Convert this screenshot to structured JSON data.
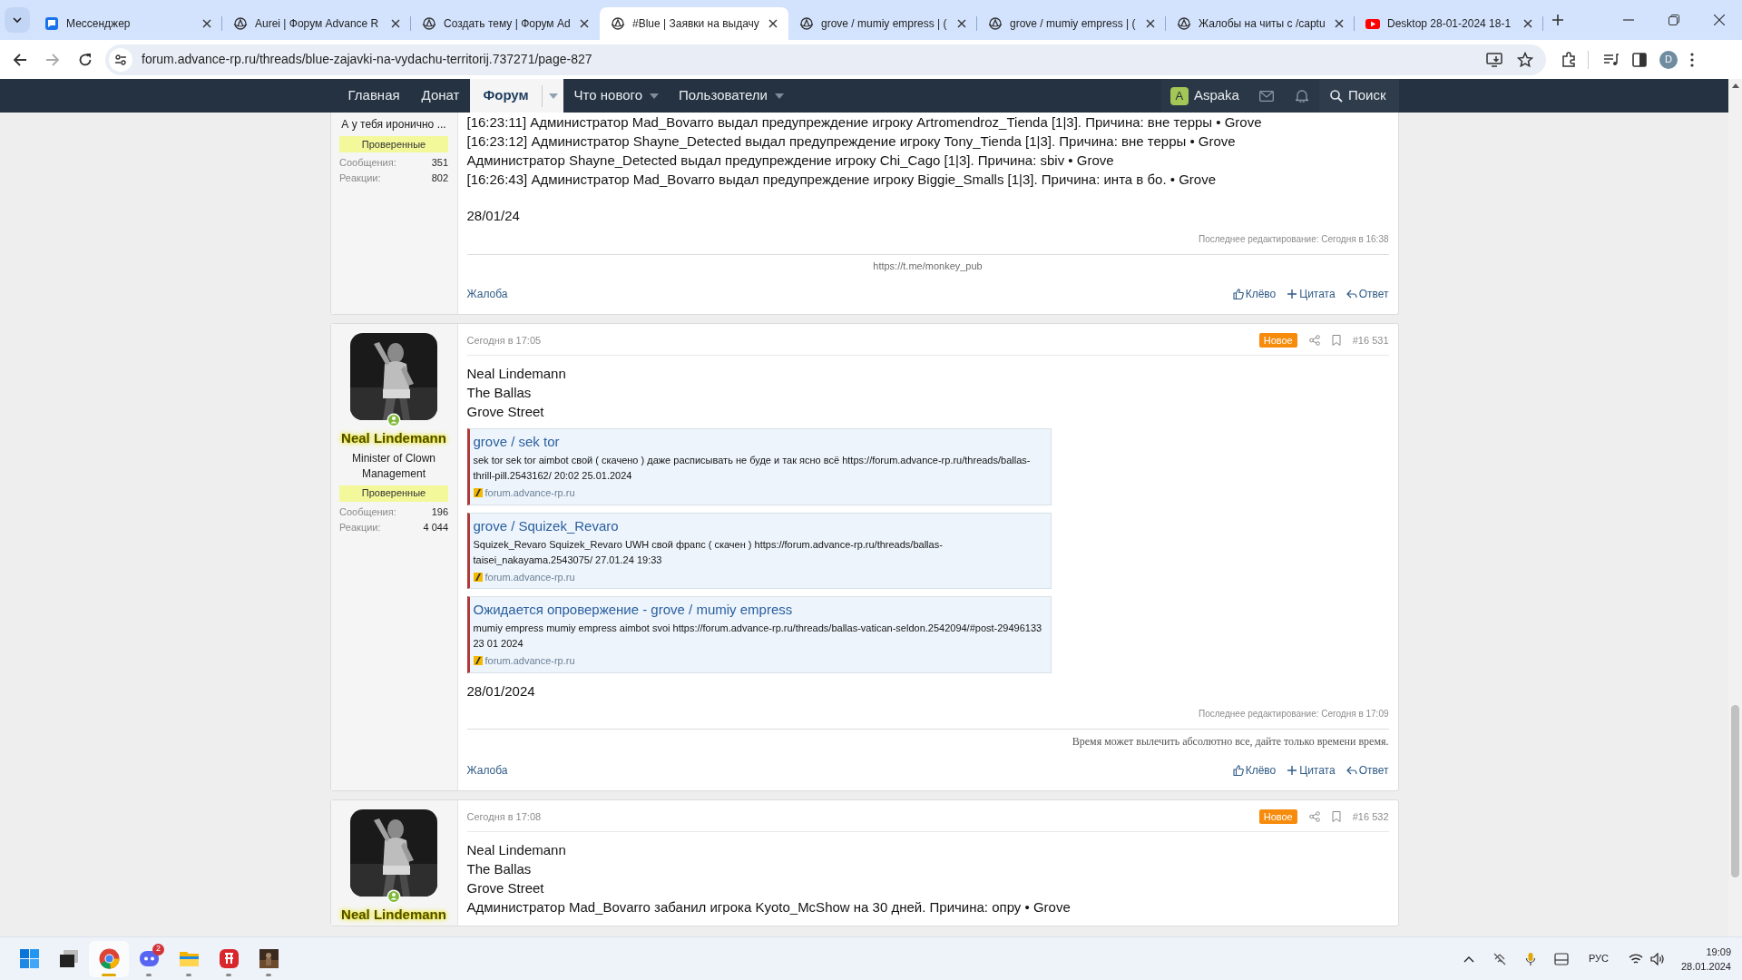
{
  "browser": {
    "tabs": [
      {
        "title": "Мессенджер",
        "kind": "messenger",
        "selected": false
      },
      {
        "title": "Aurei | Форум Advance R",
        "kind": "forum",
        "selected": false
      },
      {
        "title": "Создать тему | Форум Ad",
        "kind": "forum",
        "selected": false
      },
      {
        "title": "#Blue | Заявки на выдачу",
        "kind": "forum",
        "selected": true
      },
      {
        "title": "grove / mumiy empress | (",
        "kind": "forum",
        "selected": false
      },
      {
        "title": "grove / mumiy empress | (",
        "kind": "forum",
        "selected": false
      },
      {
        "title": "Жалобы на читы с /captu",
        "kind": "forum",
        "selected": false
      },
      {
        "title": "Desktop 28-01-2024 18-1",
        "kind": "video",
        "selected": false
      }
    ],
    "address": "forum.advance-rp.ru/threads/blue-zajavki-na-vydachu-territorij.737271/page-827",
    "profile_initial": "D"
  },
  "nav": {
    "items": [
      {
        "label": "Главная",
        "selected": false,
        "dropdown": false
      },
      {
        "label": "Донат",
        "selected": false,
        "dropdown": false
      },
      {
        "label": "Форум",
        "selected": true,
        "dropdown": true
      },
      {
        "label": "Что нового",
        "selected": false,
        "dropdown": true
      },
      {
        "label": "Пользователи",
        "selected": false,
        "dropdown": true
      }
    ],
    "user": {
      "initial": "A",
      "name": "Aspaka"
    },
    "search": "Поиск"
  },
  "posts": [
    {
      "user": {
        "title": "А у тебя иронично ...",
        "badge": "Проверенные",
        "stats": [
          {
            "label": "Сообщения:",
            "value": "351"
          },
          {
            "label": "Реакции:",
            "value": "802"
          }
        ]
      },
      "lines": [
        "[16:23:11] Администратор Mad_Bovarro выдал предупреждение игроку Artromendroz_Tienda [1|3]. Причина: вне терры • Grove",
        "[16:23:12] Администратор Shayne_Detected выдал предупреждение игроку Tony_Tienda [1|3]. Причина: вне терры • Grove",
        "Администратор Shayne_Detected выдал предупреждение игроку Chi_Cago [1|3]. Причина: sbiv • Grove",
        "[16:26:43] Администратор Mad_Bovarro выдал предупреждение игроку Biggie_Smalls [1|3]. Причина: инта в бо. • Grove"
      ],
      "date": "28/01/24",
      "last_edit": "Последнее редактирование: Сегодня в 16:38",
      "signature": {
        "text": "https://t.me/monkey_pub",
        "kind": "plain"
      },
      "actions": {
        "report": "Жалоба",
        "like": "Клёво",
        "quote": "Цитата",
        "reply": "Ответ"
      }
    },
    {
      "user": {
        "name": "Neal Lindemann",
        "online": true,
        "title": "Minister of Clown Management",
        "badge": "Проверенные",
        "stats": [
          {
            "label": "Сообщения:",
            "value": "196"
          },
          {
            "label": "Реакции:",
            "value": "4 044"
          }
        ]
      },
      "header": {
        "time": "Сегодня в 17:05",
        "badge": "Новое",
        "number": "#16 531"
      },
      "lines": [
        "Neal Lindemann",
        "The Ballas",
        "Grove Street"
      ],
      "embeds": [
        {
          "title": "grove / sek tor",
          "text": "sek tor sek tor aimbot свой ( скачено ) даже расписывать не буде и так ясно всё https://forum.advance-rp.ru/threads/ballas-thrill-pill.2543162/ 20:02 25.01.2024",
          "domain": "forum.advance-rp.ru"
        },
        {
          "title": "grove / Squizek_Revaro",
          "text": "Squizek_Revaro Squizek_Revaro UWH свой фрапс ( скачен ) https://forum.advance-rp.ru/threads/ballas-taisei_nakayama.2543075/ 27.01.24 19:33",
          "domain": "forum.advance-rp.ru"
        },
        {
          "title": "Ожидается опровержение - grove / mumiy empress",
          "text": "mumiy empress mumiy empress aimbot svoi https://forum.advance-rp.ru/threads/ballas-vatican-seldon.2542094/#post-29496133 23 01 2024",
          "domain": "forum.advance-rp.ru"
        }
      ],
      "date": "28/01/2024",
      "last_edit": "Последнее редактирование: Сегодня в 17:09",
      "signature": {
        "text": "Время может вылечить абсолютно все, дайте только времени время.",
        "kind": "serif"
      },
      "actions": {
        "report": "Жалоба",
        "like": "Клёво",
        "quote": "Цитата",
        "reply": "Ответ"
      }
    },
    {
      "user": {
        "name": "Neal Lindemann",
        "online": true
      },
      "header": {
        "time": "Сегодня в 17:08",
        "badge": "Новое",
        "number": "#16 532"
      },
      "lines": [
        "Neal Lindemann",
        "The Ballas",
        "Grove Street",
        "Администратор Mad_Bovarro забанил игрока Kyoto_McShow на 30 дней. Причина: опру • Grove"
      ]
    }
  ],
  "taskbar": {
    "apps": [
      {
        "kind": "start",
        "running": false,
        "active": false
      },
      {
        "kind": "terminal",
        "running": false,
        "active": false
      },
      {
        "kind": "chrome",
        "running": true,
        "active": true
      },
      {
        "kind": "discord",
        "running": true,
        "active": false,
        "badge": "2"
      },
      {
        "kind": "files",
        "running": true,
        "active": false
      },
      {
        "kind": "redapp",
        "running": true,
        "active": false
      },
      {
        "kind": "game",
        "running": true,
        "active": false
      }
    ],
    "lang": "РУС",
    "time": "19:09",
    "date": "28.01.2024"
  }
}
